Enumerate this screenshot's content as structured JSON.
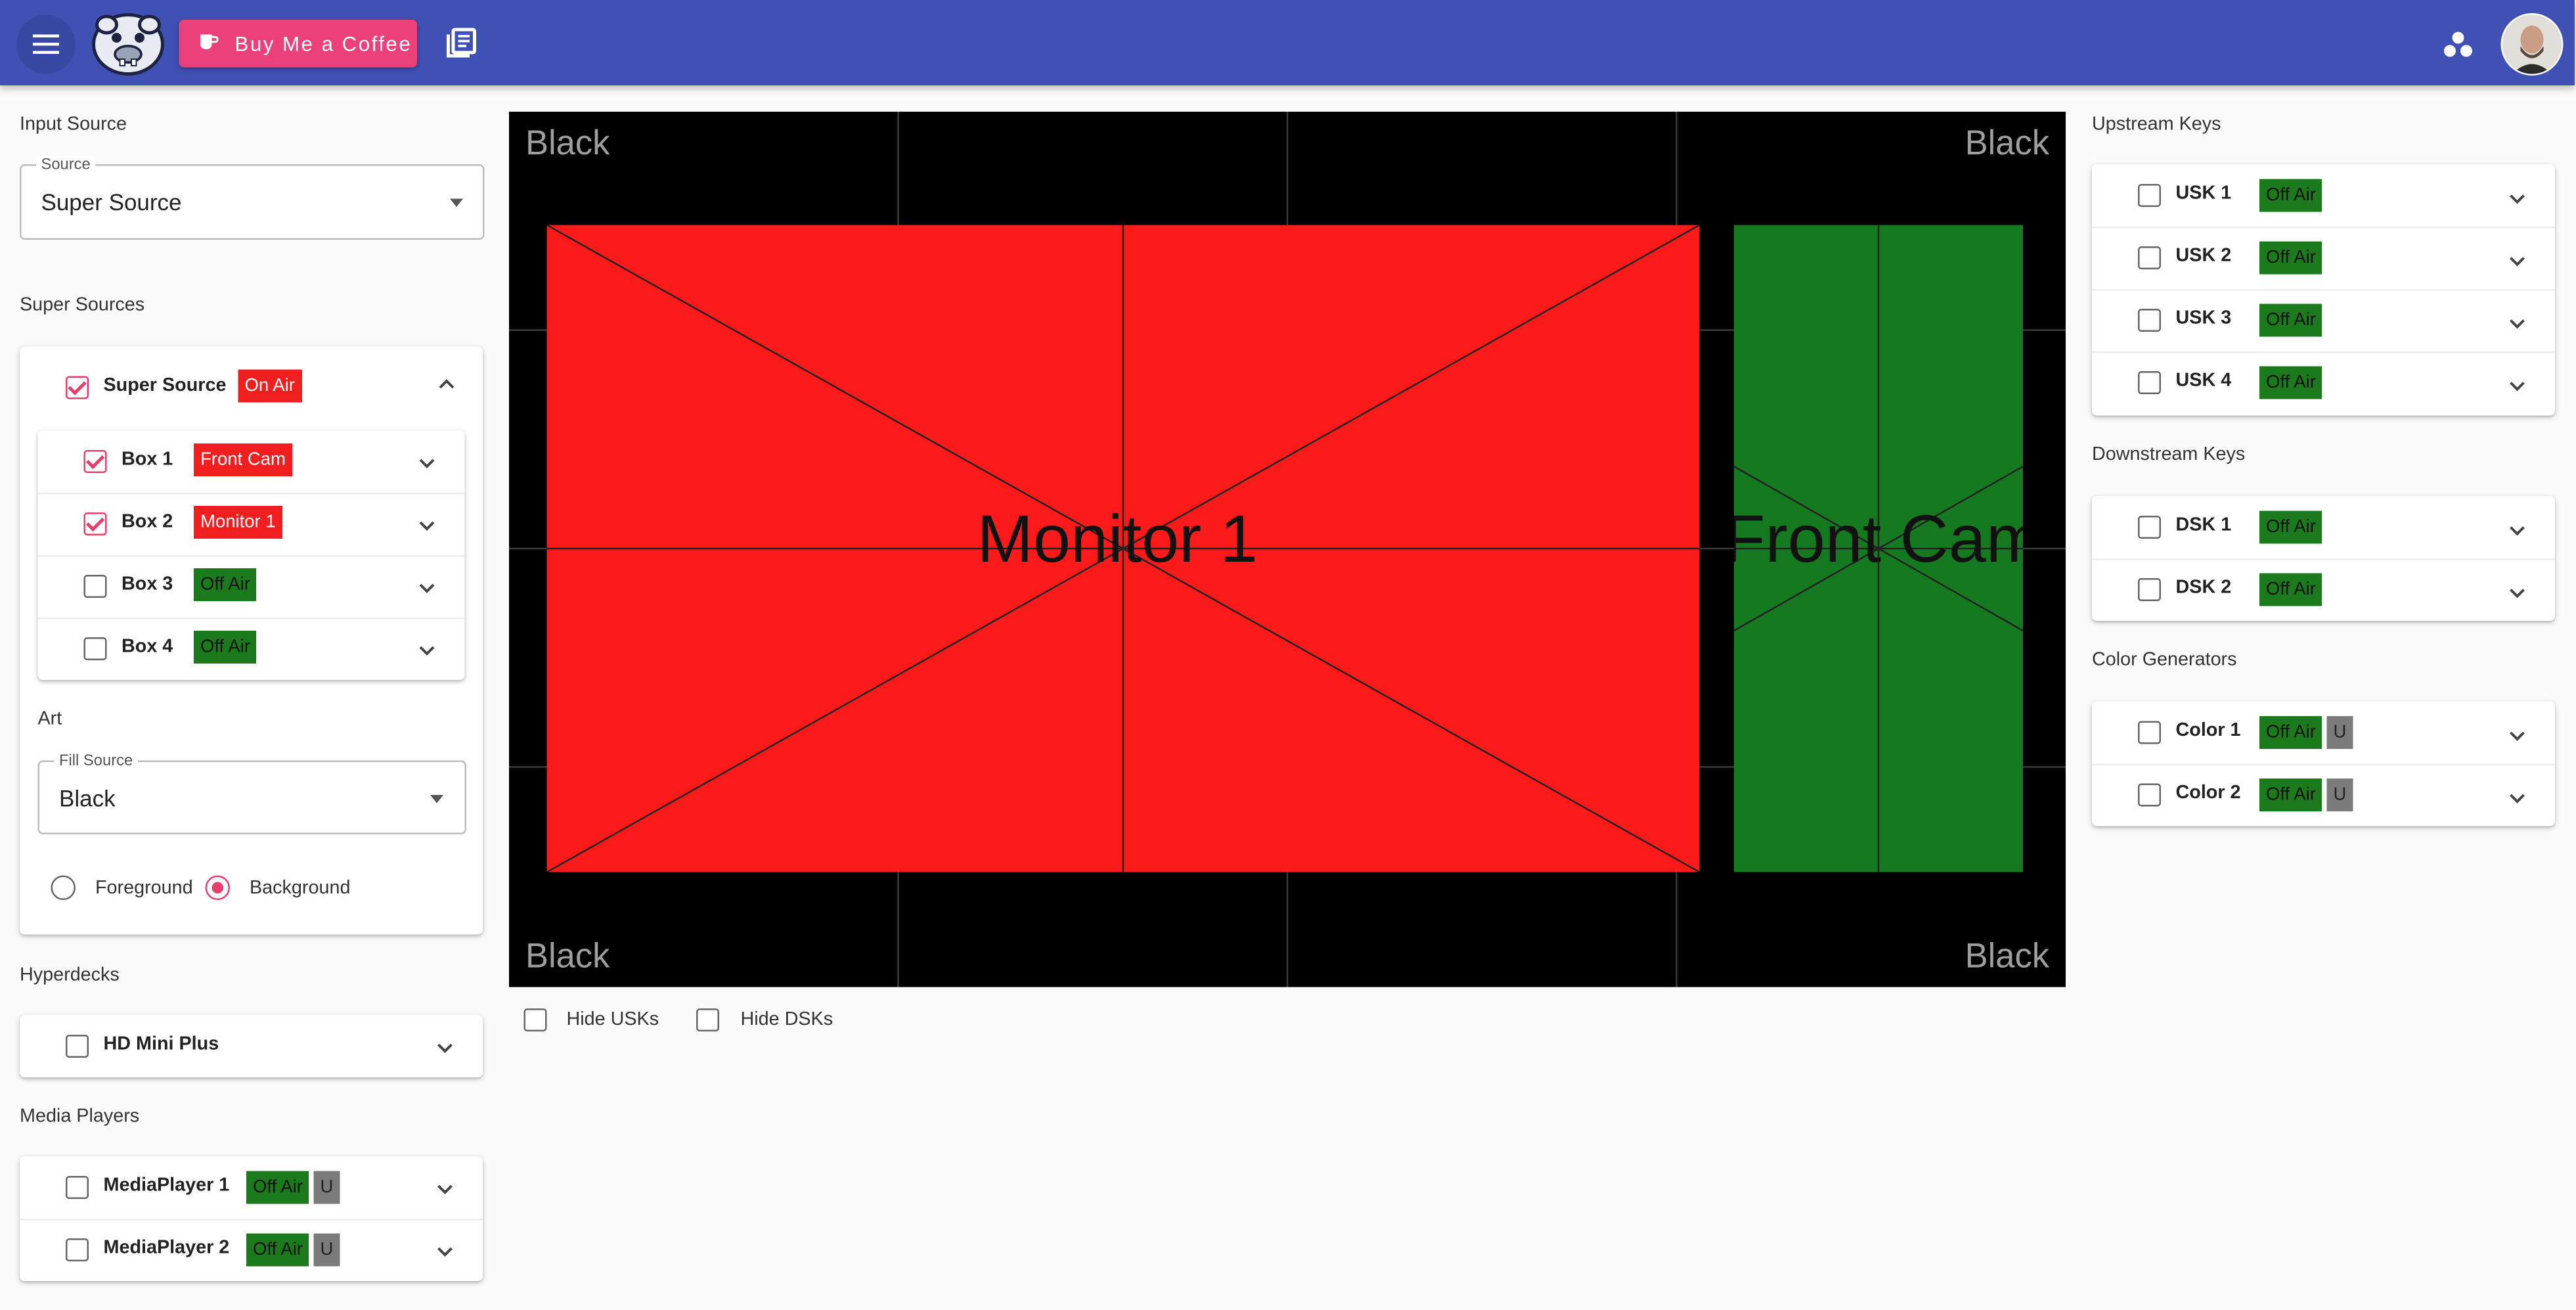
{
  "topbar": {
    "coffee_label": "Buy Me a Coffee"
  },
  "input_source": {
    "title": "Input Source",
    "legend": "Source",
    "value": "Super Source"
  },
  "super_sources": {
    "title": "Super Sources",
    "main": {
      "label": "Super Source",
      "checked": true,
      "badge": "On Air"
    },
    "boxes": [
      {
        "label": "Box 1",
        "checked": true,
        "badge": "Front Cam",
        "on_air": true
      },
      {
        "label": "Box 2",
        "checked": true,
        "badge": "Monitor 1",
        "on_air": true
      },
      {
        "label": "Box 3",
        "checked": false,
        "badge": "Off Air",
        "on_air": false
      },
      {
        "label": "Box 4",
        "checked": false,
        "badge": "Off Air",
        "on_air": false
      }
    ],
    "art": {
      "title": "Art",
      "legend": "Fill Source",
      "value": "Black",
      "foreground": "Foreground",
      "background": "Background",
      "selected": "Background"
    }
  },
  "hyperdecks": {
    "title": "Hyperdecks",
    "items": [
      {
        "label": "HD Mini Plus",
        "checked": false
      }
    ]
  },
  "media_players": {
    "title": "Media Players",
    "items": [
      {
        "label": "MediaPlayer 1",
        "badge": "Off Air",
        "u": "U"
      },
      {
        "label": "MediaPlayer 2",
        "badge": "Off Air",
        "u": "U"
      }
    ]
  },
  "preview": {
    "corner_tl": "Black",
    "corner_tr": "Black",
    "corner_bl": "Black",
    "corner_br": "Black",
    "box1_label": "Monitor 1",
    "box2_label": "Front Cam",
    "hide_usks": "Hide USKs",
    "hide_dsks": "Hide DSKs"
  },
  "upstream_keys": {
    "title": "Upstream Keys",
    "items": [
      {
        "label": "USK 1",
        "badge": "Off Air"
      },
      {
        "label": "USK 2",
        "badge": "Off Air"
      },
      {
        "label": "USK 3",
        "badge": "Off Air"
      },
      {
        "label": "USK 4",
        "badge": "Off Air"
      }
    ]
  },
  "downstream_keys": {
    "title": "Downstream Keys",
    "items": [
      {
        "label": "DSK 1",
        "badge": "Off Air"
      },
      {
        "label": "DSK 2",
        "badge": "Off Air"
      }
    ]
  },
  "color_generators": {
    "title": "Color Generators",
    "items": [
      {
        "label": "Color 1",
        "badge": "Off Air",
        "u": "U"
      },
      {
        "label": "Color 2",
        "badge": "Off Air",
        "u": "U"
      }
    ]
  },
  "colors": {
    "appbar": "#3f51b5",
    "accent": "#e83e6c",
    "on_air": "#f01e1e",
    "off_air": "#1b7a1b",
    "box1_fill": "#fa1a1a",
    "box2_fill": "#157a1f"
  },
  "icons": [
    "menu-icon",
    "logo",
    "coffee-cup-icon",
    "docs-icon",
    "dots-icon",
    "avatar",
    "chevron-down-icon",
    "chevron-up-icon"
  ]
}
